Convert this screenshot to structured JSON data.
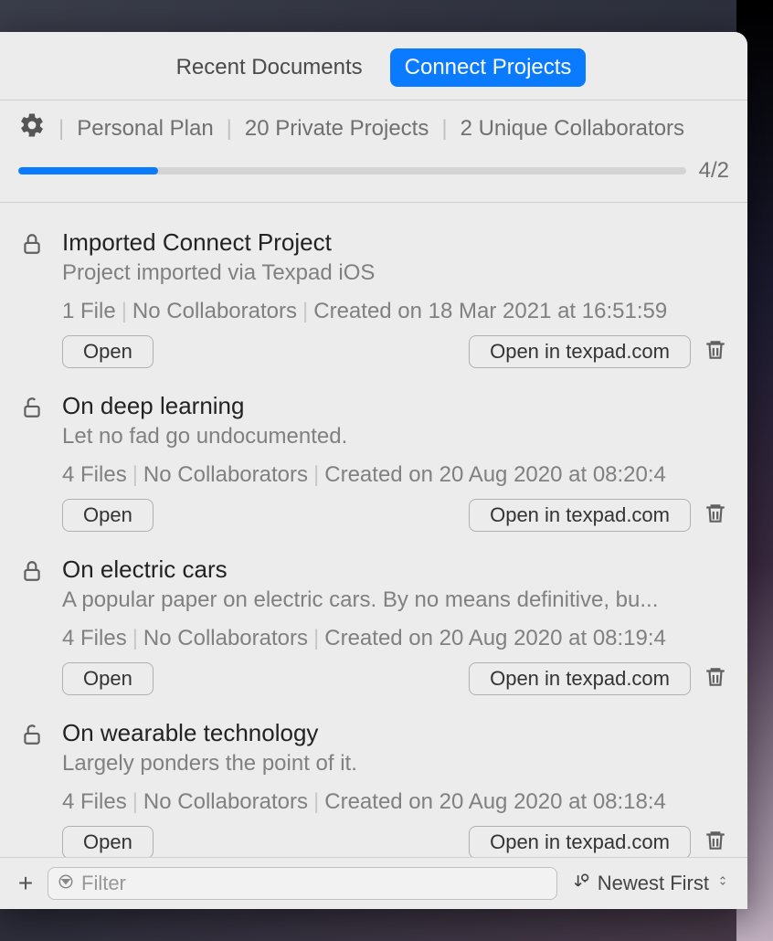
{
  "tabs": {
    "recent": "Recent Documents",
    "connect": "Connect Projects"
  },
  "plan": {
    "name": "Personal Plan",
    "projects": "20 Private Projects",
    "collabs": "2 Unique Collaborators",
    "bar_label": "4/2"
  },
  "projects": [
    {
      "title": "Imported Connect Project",
      "subtitle": "Project imported via Texpad iOS",
      "files": "1 File",
      "collabs": "No Collaborators",
      "created": "Created on 18 Mar 2021 at 16:51:59",
      "open": "Open",
      "open_web": "Open in texpad.com",
      "locked": true
    },
    {
      "title": "On deep learning",
      "subtitle": "Let no fad go undocumented.",
      "files": "4 Files",
      "collabs": "No Collaborators",
      "created": "Created on 20 Aug 2020 at 08:20:4",
      "open": "Open",
      "open_web": "Open in texpad.com",
      "locked": false
    },
    {
      "title": "On electric cars",
      "subtitle": "A popular paper on electric cars. By no means definitive, bu...",
      "files": "4 Files",
      "collabs": "No Collaborators",
      "created": "Created on 20 Aug 2020 at 08:19:4",
      "open": "Open",
      "open_web": "Open in texpad.com",
      "locked": true
    },
    {
      "title": "On wearable technology",
      "subtitle": "Largely ponders the point of it.",
      "files": "4 Files",
      "collabs": "No Collaborators",
      "created": "Created on 20 Aug 2020 at 08:18:4",
      "open": "Open",
      "open_web": "Open in texpad.com",
      "locked": false
    }
  ],
  "footer": {
    "filter_placeholder": "Filter",
    "sort_label": "Newest First"
  }
}
